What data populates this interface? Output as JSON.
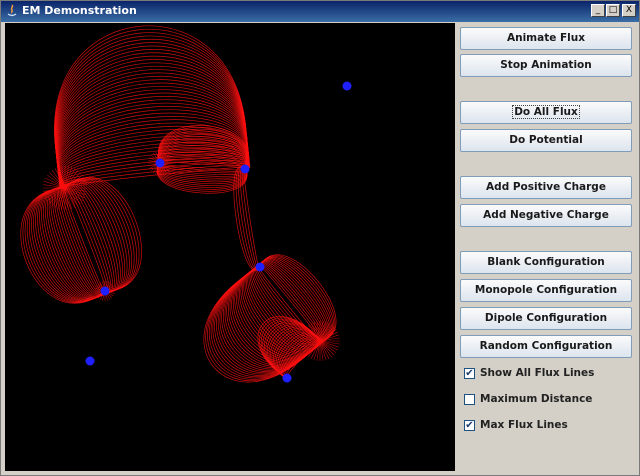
{
  "window": {
    "title": "EM Demonstration"
  },
  "titlebar_buttons": {
    "minimize": "_",
    "maximize": "□",
    "close": "X"
  },
  "buttons": {
    "animate_flux": "Animate Flux",
    "stop_animation": "Stop Animation",
    "do_all_flux": "Do All Flux",
    "do_potential": "Do Potential",
    "add_positive": "Add Positive Charge",
    "add_negative": "Add Negative Charge",
    "blank_config": "Blank Configuration",
    "monopole_config": "Monopole Configuration",
    "dipole_config": "Dipole Configuration",
    "random_config": "Random Configuration"
  },
  "checkboxes": {
    "show_all_flux": {
      "label": "Show All Flux Lines",
      "checked": true,
      "mark": "✔"
    },
    "max_distance": {
      "label": "Maximum Distance",
      "checked": false,
      "mark": ""
    },
    "max_flux_lines": {
      "label": "Max Flux Lines",
      "checked": true,
      "mark": "✔"
    }
  },
  "colors": {
    "field_lines": "#ff1010",
    "charges": "#2020ff",
    "background": "#000000"
  }
}
